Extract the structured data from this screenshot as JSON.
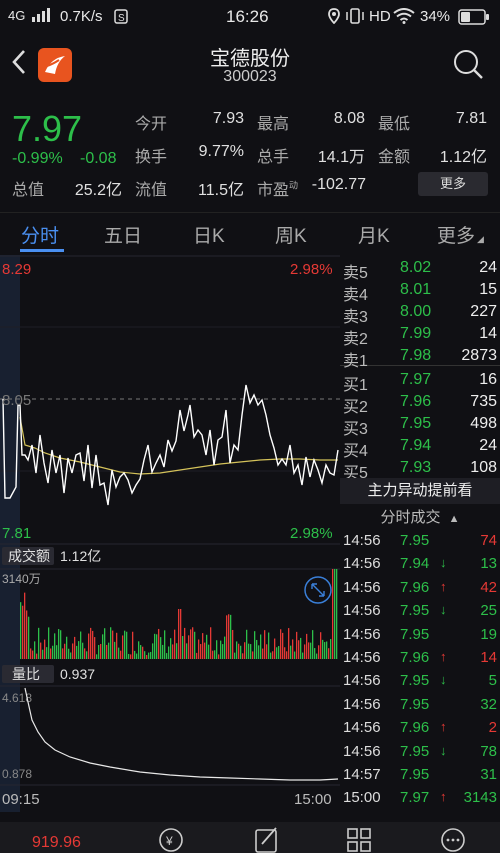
{
  "status": {
    "network": "4G",
    "speed": "0.7K/s",
    "time": "16:26",
    "hd": "HD",
    "battery": "34%"
  },
  "header": {
    "name": "宝德股份",
    "code": "300023"
  },
  "quote": {
    "price": "7.97",
    "change_pct": "-0.99%",
    "change": "-0.08",
    "open_label": "今开",
    "open": "7.93",
    "high_label": "最高",
    "high": "8.08",
    "low_label": "最低",
    "low": "7.81",
    "turnover_label": "换手",
    "turnover": "9.77%",
    "hands_label": "总手",
    "hands": "14.1万",
    "amount_label": "金额",
    "amount": "1.12亿",
    "total_cap_label": "总值",
    "total_cap": "25.2亿",
    "float_cap_label": "流值",
    "float_cap": "11.5亿",
    "pe_label": "市盈",
    "pe_sup": "动",
    "pe": "-102.77",
    "more": "更多"
  },
  "tabs": [
    {
      "label": "分时"
    },
    {
      "label": "五日"
    },
    {
      "label": "日K"
    },
    {
      "label": "周K"
    },
    {
      "label": "月K"
    },
    {
      "label": "更多"
    }
  ],
  "chart": {
    "top_left": "8.29",
    "top_right": "2.98%",
    "mid_left": "8.05",
    "bottom_left": "7.81",
    "bottom_right": "2.98%",
    "volume_label": "成交额",
    "volume_value": "1.12亿",
    "volume_scale": "3140万",
    "ratio_label": "量比",
    "ratio_value": "0.937",
    "ratio_top": "4.618",
    "ratio_bottom": "0.878",
    "time_start": "09:15",
    "time_end": "15:00",
    "colors": {
      "price_line": "#ffffff",
      "avg_line": "#d4c25a",
      "up": "#e53935",
      "down": "#2dbf4a"
    }
  },
  "orderbook": [
    {
      "label": "卖5",
      "price": "8.02",
      "vol": "24"
    },
    {
      "label": "卖4",
      "price": "8.01",
      "vol": "15"
    },
    {
      "label": "卖3",
      "price": "8.00",
      "vol": "227"
    },
    {
      "label": "卖2",
      "price": "7.99",
      "vol": "14"
    },
    {
      "label": "卖1",
      "price": "7.98",
      "vol": "2873"
    },
    {
      "label": "买1",
      "price": "7.97",
      "vol": "16"
    },
    {
      "label": "买2",
      "price": "7.96",
      "vol": "735"
    },
    {
      "label": "买3",
      "price": "7.95",
      "vol": "498"
    },
    {
      "label": "买4",
      "price": "7.94",
      "vol": "24"
    },
    {
      "label": "买5",
      "price": "7.93",
      "vol": "108"
    }
  ],
  "anomaly": "主力异动提前看",
  "ticks_header": "分时成交",
  "ticks": [
    {
      "time": "14:56",
      "price": "7.95",
      "arrow": "",
      "vol": "74",
      "vol_color": "red"
    },
    {
      "time": "14:56",
      "price": "7.94",
      "arrow": "↓",
      "vol": "13",
      "vol_color": "green"
    },
    {
      "time": "14:56",
      "price": "7.96",
      "arrow": "↑",
      "vol": "42",
      "vol_color": "red"
    },
    {
      "time": "14:56",
      "price": "7.95",
      "arrow": "↓",
      "vol": "25",
      "vol_color": "green"
    },
    {
      "time": "14:56",
      "price": "7.95",
      "arrow": "",
      "vol": "19",
      "vol_color": "green"
    },
    {
      "time": "14:56",
      "price": "7.96",
      "arrow": "↑",
      "vol": "14",
      "vol_color": "red"
    },
    {
      "time": "14:56",
      "price": "7.95",
      "arrow": "↓",
      "vol": "5",
      "vol_color": "green"
    },
    {
      "time": "14:56",
      "price": "7.95",
      "arrow": "",
      "vol": "32",
      "vol_color": "green"
    },
    {
      "time": "14:56",
      "price": "7.96",
      "arrow": "↑",
      "vol": "2",
      "vol_color": "red"
    },
    {
      "time": "14:56",
      "price": "7.95",
      "arrow": "↓",
      "vol": "78",
      "vol_color": "green"
    },
    {
      "time": "14:57",
      "price": "7.95",
      "arrow": "",
      "vol": "31",
      "vol_color": "green"
    },
    {
      "time": "15:00",
      "price": "7.97",
      "arrow": "↑",
      "vol": "3143",
      "vol_color": "green"
    }
  ],
  "bottom": {
    "index_value": "919.96"
  }
}
